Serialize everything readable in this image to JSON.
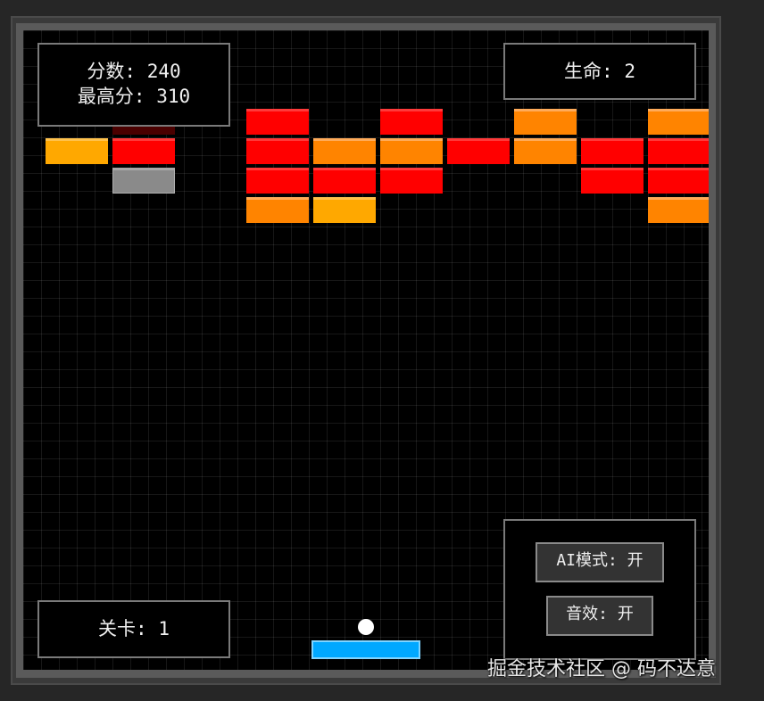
{
  "hud": {
    "score_label": "分数:",
    "score_value": "240",
    "high_score_label": "最高分:",
    "high_score_value": "310",
    "lives_label": "生命:",
    "lives_value": "2",
    "level_label": "关卡:",
    "level_value": "1"
  },
  "controls": {
    "ai_mode_label": "AI模式: 开",
    "sound_label": "音效: 开"
  },
  "watermark": "掘金技术社区 @ 码不达意",
  "colors": {
    "red": "#ff0000",
    "orange": "#ff8400",
    "amber": "#ffa800",
    "gray": "#8a8a8a",
    "paddle": "#00a8ff",
    "ball": "#ffffff",
    "background": "#000000"
  },
  "bricks": [
    {
      "col": 1,
      "row": 0,
      "type": "darkred"
    },
    {
      "col": 3,
      "row": 0,
      "type": "red"
    },
    {
      "col": 5,
      "row": 0,
      "type": "red"
    },
    {
      "col": 7,
      "row": 0,
      "type": "orange"
    },
    {
      "col": 9,
      "row": 0,
      "type": "orange"
    },
    {
      "col": 0,
      "row": 1,
      "type": "amber"
    },
    {
      "col": 1,
      "row": 1,
      "type": "red"
    },
    {
      "col": 3,
      "row": 1,
      "type": "red"
    },
    {
      "col": 4,
      "row": 1,
      "type": "orange"
    },
    {
      "col": 5,
      "row": 1,
      "type": "orange"
    },
    {
      "col": 6,
      "row": 1,
      "type": "red"
    },
    {
      "col": 7,
      "row": 1,
      "type": "orange"
    },
    {
      "col": 8,
      "row": 1,
      "type": "red"
    },
    {
      "col": 9,
      "row": 1,
      "type": "red"
    },
    {
      "col": 1,
      "row": 2,
      "type": "gray"
    },
    {
      "col": 3,
      "row": 2,
      "type": "red"
    },
    {
      "col": 4,
      "row": 2,
      "type": "red"
    },
    {
      "col": 5,
      "row": 2,
      "type": "red"
    },
    {
      "col": 8,
      "row": 2,
      "type": "red"
    },
    {
      "col": 9,
      "row": 2,
      "type": "red"
    },
    {
      "col": 3,
      "row": 3,
      "type": "orange"
    },
    {
      "col": 4,
      "row": 3,
      "type": "amber"
    },
    {
      "col": 9,
      "row": 3,
      "type": "orange"
    }
  ]
}
